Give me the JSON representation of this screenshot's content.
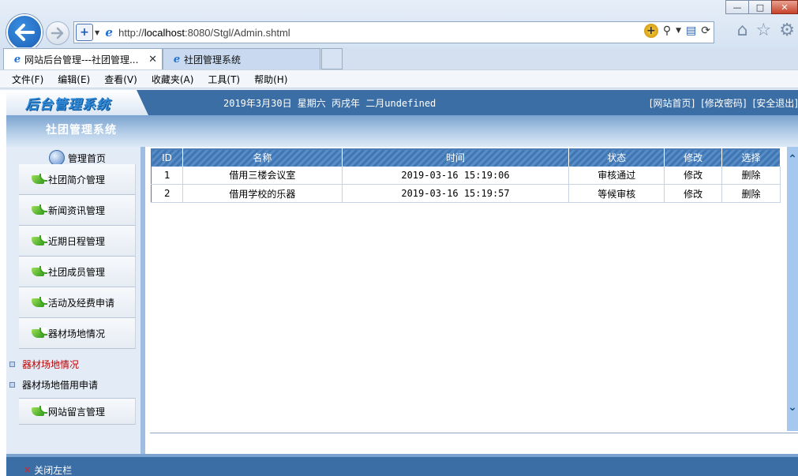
{
  "browser": {
    "url_prefix": "http://",
    "url_host": "localhost",
    "url_rest": ":8080/Stgl/Admin.shtml",
    "tabs": [
      {
        "label": "网站后台管理---社团管理..."
      },
      {
        "label": "社团管理系统"
      }
    ],
    "menu": [
      "文件(F)",
      "编辑(E)",
      "查看(V)",
      "收藏夹(A)",
      "工具(T)",
      "帮助(H)"
    ]
  },
  "header": {
    "logo": "后台管理系统",
    "date": "2019年3月30日 星期六 丙戌年 二月undefined",
    "links": [
      "[网站首页]",
      "[修改密码]",
      "[安全退出]"
    ]
  },
  "subheader": {
    "system_name": "社团管理系统"
  },
  "sidebar": {
    "home": "管理首页",
    "items": [
      "社团简介管理",
      "新闻资讯管理",
      "近期日程管理",
      "社团成员管理",
      "活动及经费申请",
      "器材场地情况",
      "网站留言管理"
    ],
    "subitems": [
      "器材场地情况",
      "器材场地借用申请"
    ],
    "close": "关闭左栏"
  },
  "table": {
    "headers": [
      "ID",
      "名称",
      "时间",
      "状态",
      "修改",
      "选择"
    ],
    "rows": [
      {
        "id": "1",
        "name": "借用三楼会议室",
        "time": "2019-03-16 15:19:06",
        "status": "审核通过",
        "edit": "修改",
        "del": "删除"
      },
      {
        "id": "2",
        "name": "借用学校的乐器",
        "time": "2019-03-16 15:19:57",
        "status": "等候审核",
        "edit": "修改",
        "del": "删除"
      }
    ]
  },
  "colors": {
    "header_bg": "#3b6ea5",
    "active_sub": "#c00000"
  }
}
